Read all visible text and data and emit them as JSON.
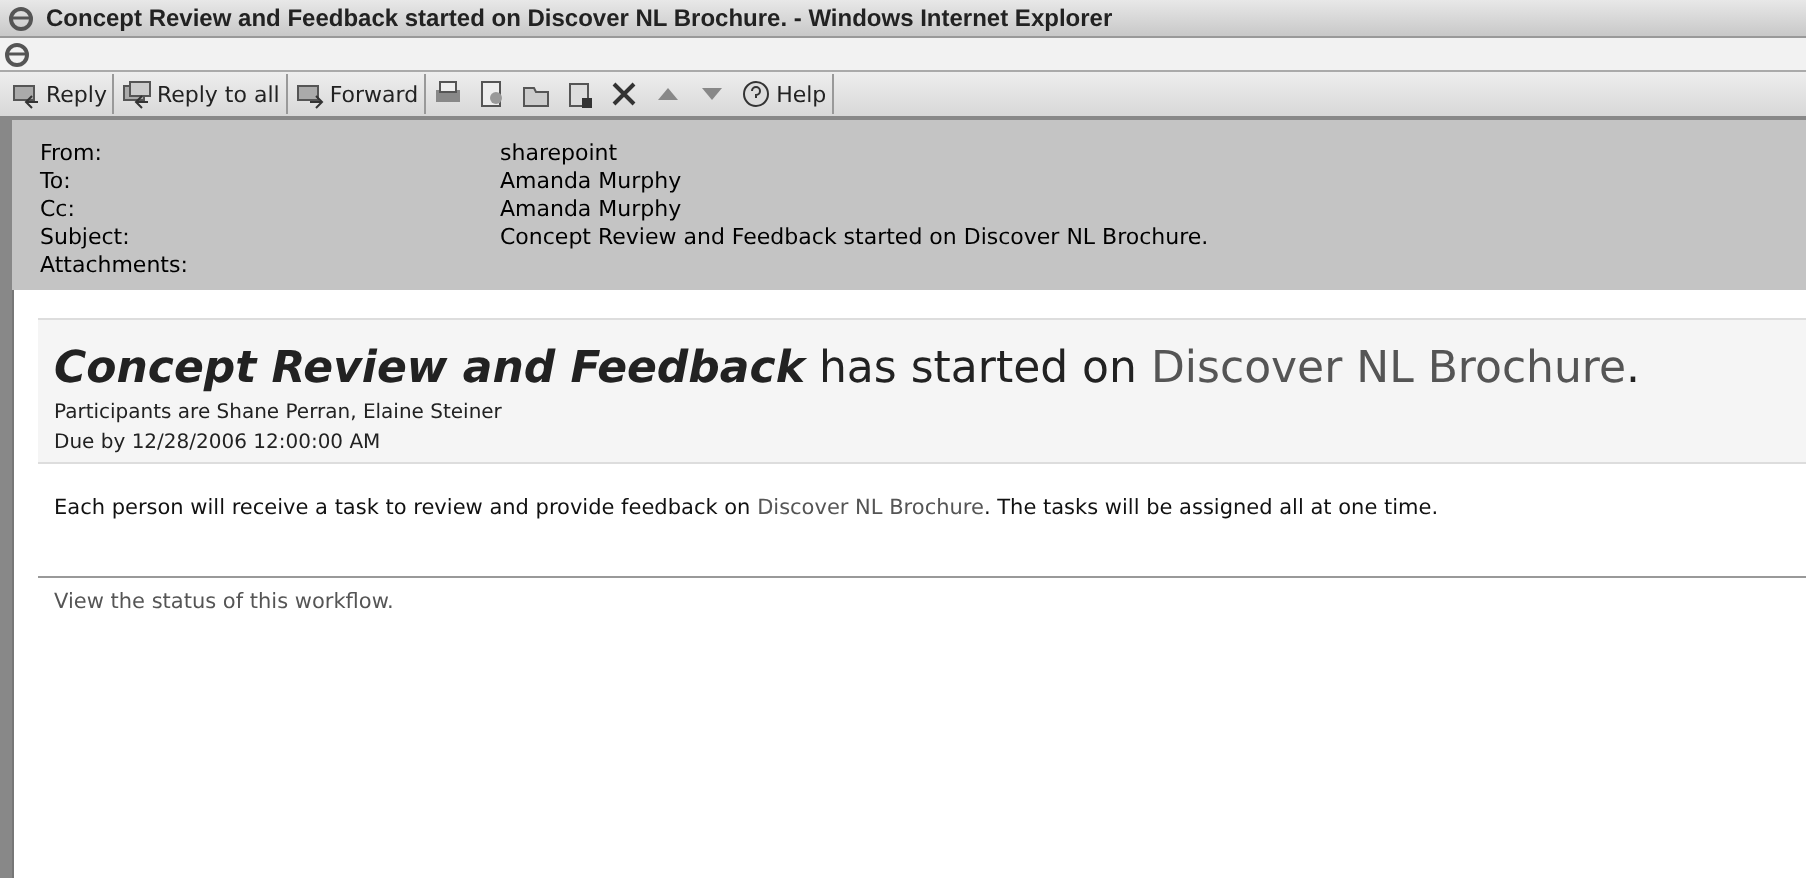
{
  "window": {
    "title": "Concept Review and Feedback started on Discover NL Brochure. - Windows Internet Explorer"
  },
  "toolbar": [
    {
      "kind": "labeled",
      "label": "Reply"
    },
    {
      "kind": "labeled",
      "label": "Reply to all"
    },
    {
      "kind": "labeled",
      "label": "Forward"
    },
    {
      "kind": "icon"
    },
    {
      "kind": "icon"
    },
    {
      "kind": "icon"
    },
    {
      "kind": "icon"
    },
    {
      "kind": "icon"
    },
    {
      "kind": "icon"
    },
    {
      "kind": "icon"
    },
    {
      "kind": "labeled",
      "label": "Help"
    }
  ],
  "header": [
    {
      "label": "From:",
      "value": "sharepoint"
    },
    {
      "label": "To:",
      "value": "Amanda Murphy"
    },
    {
      "label": "Cc:",
      "value": "Amanda Murphy"
    },
    {
      "label": "Subject:",
      "value": "Concept Review and Feedback started on Discover NL Brochure."
    },
    {
      "label": "Attachments:"
    }
  ],
  "message": {
    "heading": {
      "workflow": "Concept Review and Feedback",
      "middle": " has started on ",
      "link": "Discover NL Brochure",
      "end": "."
    },
    "participants": "Participants are Shane Perran, Elaine Steiner",
    "due": "Due by 12/28/2006 12:00:00 AM",
    "body": {
      "before": "Each person will receive a task to review and provide feedback on ",
      "link": "Discover NL Brochure",
      "after": ". The tasks will be assigned all at one time."
    },
    "status_link": "View the status of this workflow."
  }
}
